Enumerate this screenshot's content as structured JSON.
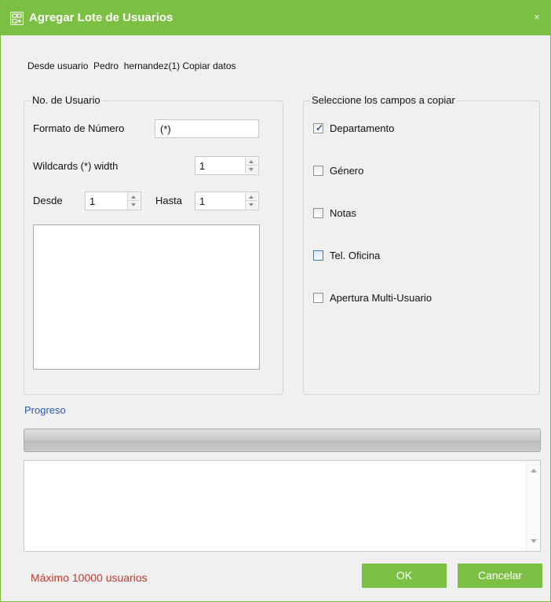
{
  "window": {
    "title": "Agregar Lote de Usuarios",
    "close_glyph": "×",
    "title_icon": "add-batch-users-icon",
    "accent_color": "#7cc043"
  },
  "copy_source": {
    "text": "Desde usuario  Pedro  hernandez(1) Copiar datos"
  },
  "user_number_group": {
    "legend": "No. de Usuario",
    "format_label": "Formato de Número",
    "format_value": "(*)",
    "wildcards_label": "Wildcards (*) width",
    "wildcards_value": "1",
    "from_label": "Desde",
    "from_value": "1",
    "to_label": "Hasta",
    "to_value": "1"
  },
  "copy_fields_group": {
    "legend": "Seleccione los campos a copiar",
    "fields": [
      {
        "label": "Departamento",
        "checked": true
      },
      {
        "label": "Género",
        "checked": false
      },
      {
        "label": "Notas",
        "checked": false
      },
      {
        "label": "Tel. Oficina",
        "checked": false
      },
      {
        "label": "Apertura Multi-Usuario",
        "checked": false
      }
    ]
  },
  "progress": {
    "label": "Progreso",
    "percent": 0
  },
  "footer": {
    "limit_text": "Máximo 10000 usuarios",
    "limit_color": "#c0392b",
    "ok_label": "OK",
    "cancel_label": "Cancelar"
  }
}
